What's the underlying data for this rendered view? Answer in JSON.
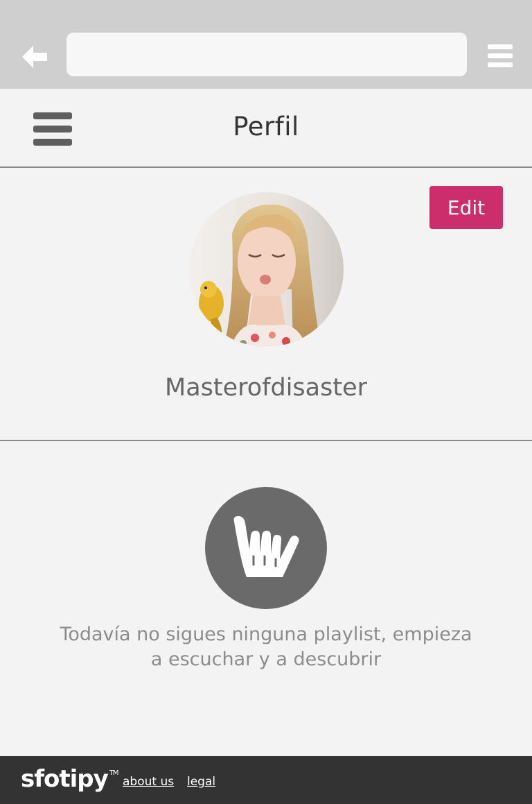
{
  "browser": {
    "url_value": "",
    "back_icon": "arrow-left-icon",
    "menu_icon": "hamburger-icon"
  },
  "header": {
    "menu_icon": "hamburger-icon",
    "title": "Perfil"
  },
  "profile": {
    "edit_label": "Edit",
    "username": "Masterofdisaster",
    "avatar": "profile-photo"
  },
  "empty_state": {
    "icon": "shaka-hand-icon",
    "line1": "Todavía no sigues ninguna playlist, empieza",
    "line2": "a escuchar y a descubrir"
  },
  "footer": {
    "logo": "sfotipy",
    "trademark": "TM",
    "links": [
      "about us",
      "legal"
    ]
  },
  "colors": {
    "accent": "#cc2e6c",
    "footer_bg": "#333333",
    "chrome_bg": "#cfcfcf",
    "page_bg": "#f3f3f3",
    "icon_gray": "#6a6a6a"
  }
}
